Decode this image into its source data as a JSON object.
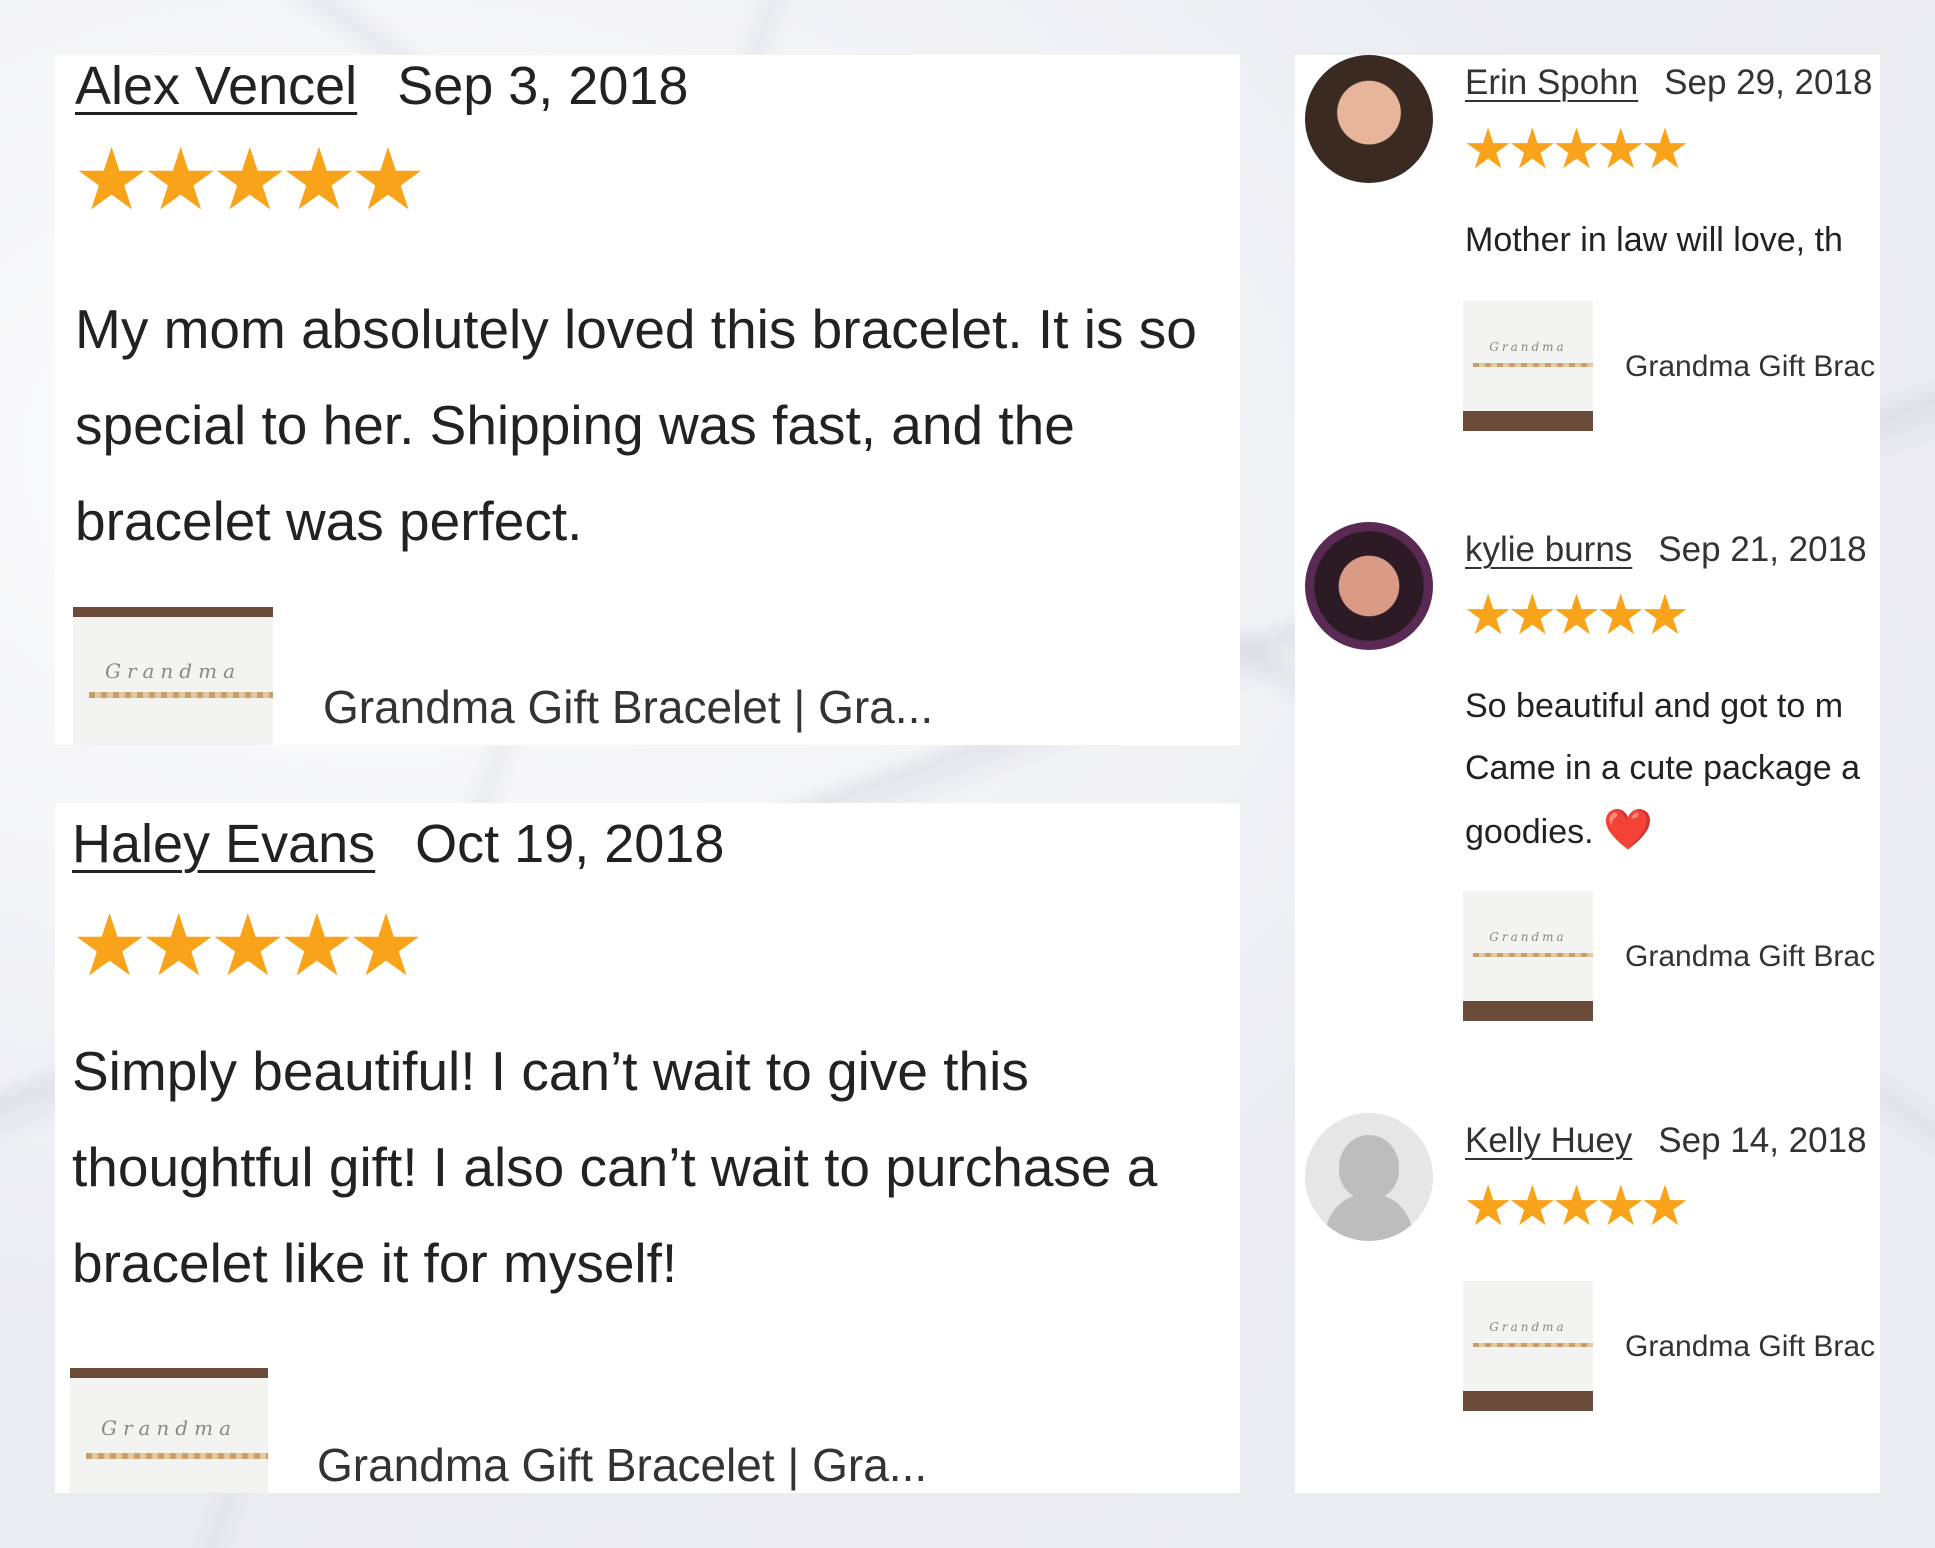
{
  "reviews_main": [
    {
      "name": "Alex Vencel",
      "date": "Sep 3, 2018",
      "rating": 5,
      "text": "My mom absolutely loved this bracelet. It is so special to her. Shipping was fast, and the bracelet was perfect.",
      "product": "Grandma Gift Bracelet | Gra..."
    },
    {
      "name": "Haley Evans",
      "date": "Oct 19, 2018",
      "rating": 5,
      "text": "Simply beautiful! I can’t wait to give this thoughtful gift! I also can’t wait to purchase a bracelet like it for myself!",
      "product": "Grandma Gift Bracelet | Gra..."
    }
  ],
  "reviews_side": [
    {
      "name": "Erin Spohn",
      "date": "Sep 29, 2018",
      "rating": 5,
      "text_lines": [
        "Mother in law will love, th"
      ],
      "product": "Grandma Gift Brac"
    },
    {
      "name": "kylie burns",
      "date": "Sep 21, 2018",
      "rating": 5,
      "text_lines": [
        "So beautiful and got to m",
        "Came in a cute package a",
        "goodies."
      ],
      "emoji": "❤️",
      "product": "Grandma Gift Brac"
    },
    {
      "name": "Kelly Huey",
      "date": "Sep 14, 2018",
      "rating": 5,
      "product": "Grandma Gift Brac"
    }
  ],
  "thumbnail_script": "Grandma",
  "colors": {
    "star": "#f9a31b",
    "heart": "#e02020",
    "card": "#ffffff"
  }
}
